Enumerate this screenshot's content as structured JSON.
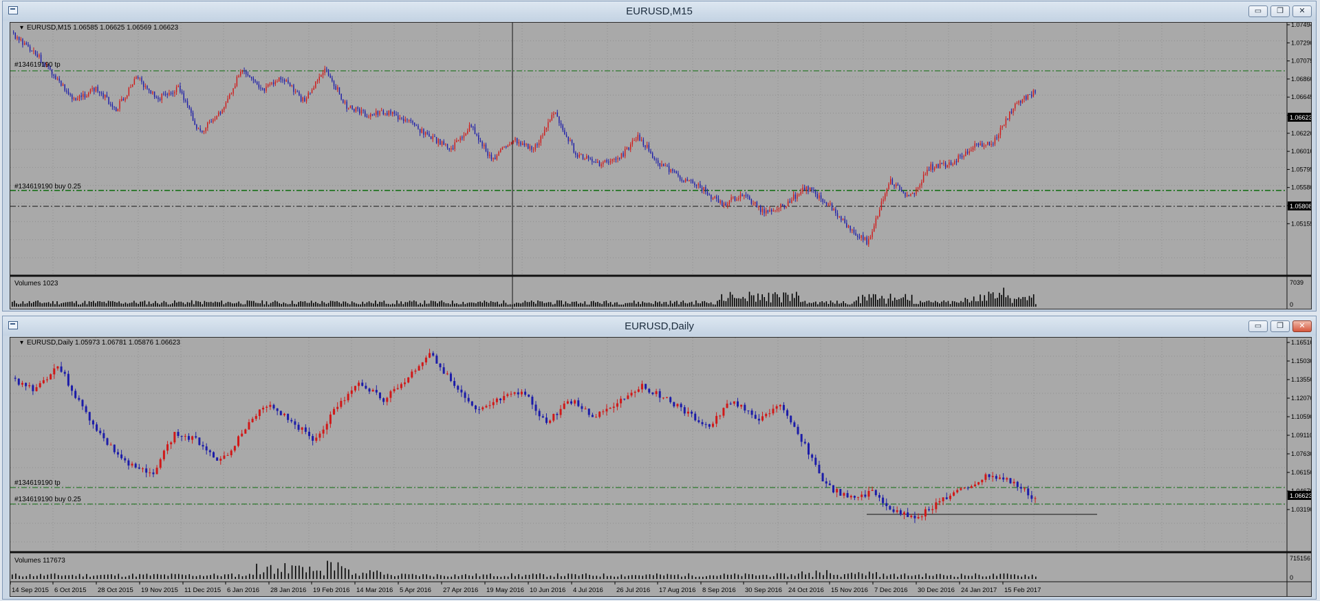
{
  "windows": [
    {
      "title": "EURUSD,M15",
      "info_line": "EURUSD,M15  1.06585 1.06625 1.06569 1.06623",
      "order_tp_label": "#134619190 tp",
      "order_buy_label": "#134619190 buy 0.25",
      "price_axis": [
        "1.07494",
        "1.07290",
        "1.07075",
        "1.06860",
        "1.06645",
        "1.06435",
        "1.06220",
        "1.06010",
        "1.05795",
        "1.05580",
        "1.05370",
        "1.05155"
      ],
      "current_price": "1.06623",
      "level_price": "1.05808",
      "volume_label": "Volumes 1023",
      "volume_axis": [
        "7039",
        "0"
      ],
      "colors": {
        "bull": "#d01818",
        "bear": "#1c1ca8",
        "grid": "#0a6a0a"
      }
    },
    {
      "title": "EURUSD,Daily",
      "info_line": "EURUSD,Daily  1.05973 1.06781 1.05876 1.06623",
      "order_tp_label": "#134619190 tp",
      "order_buy_label": "#134619190 buy 0.25",
      "price_axis": [
        "1.16510",
        "1.15030",
        "1.13550",
        "1.12070",
        "1.10590",
        "1.09110",
        "1.07630",
        "1.06150",
        "1.04670",
        "1.03190"
      ],
      "current_price": "1.06623",
      "volume_label": "Volumes 117673",
      "volume_axis": [
        "715156",
        "0"
      ],
      "time_axis": [
        "14 Sep 2015",
        "6 Oct 2015",
        "28 Oct 2015",
        "19 Nov 2015",
        "11 Dec 2015",
        "6 Jan 2016",
        "28 Jan 2016",
        "19 Feb 2016",
        "14 Mar 2016",
        "5 Apr 2016",
        "27 Apr 2016",
        "19 May 2016",
        "10 Jun 2016",
        "4 Jul 2016",
        "26 Jul 2016",
        "17 Aug 2016",
        "8 Sep 2016",
        "30 Sep 2016",
        "24 Oct 2016",
        "15 Nov 2016",
        "7 Dec 2016",
        "30 Dec 2016",
        "24 Jan 2017",
        "15 Feb 2017"
      ],
      "colors": {
        "bull": "#d01818",
        "bear": "#1c1ca8",
        "grid": "#0a6a0a"
      }
    }
  ],
  "window_buttons": {
    "minimize": "▭",
    "maximize": "❐",
    "close": "✕"
  }
}
